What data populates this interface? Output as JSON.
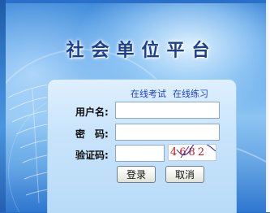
{
  "header": {
    "title": "社会单位平台"
  },
  "links": {
    "online_exam": "在线考试",
    "online_practice": "在线练习"
  },
  "form": {
    "username_label": "用户名:",
    "password_label": "密　码:",
    "captcha_label": "验证码:",
    "username_value": "",
    "password_value": "",
    "captcha_value": "",
    "captcha_image_text": "4682"
  },
  "buttons": {
    "login": "登录",
    "cancel": "取消"
  },
  "colors": {
    "title": "#1c3f8f",
    "link": "#1b3fd1",
    "captcha_text": "#c81c1c"
  }
}
